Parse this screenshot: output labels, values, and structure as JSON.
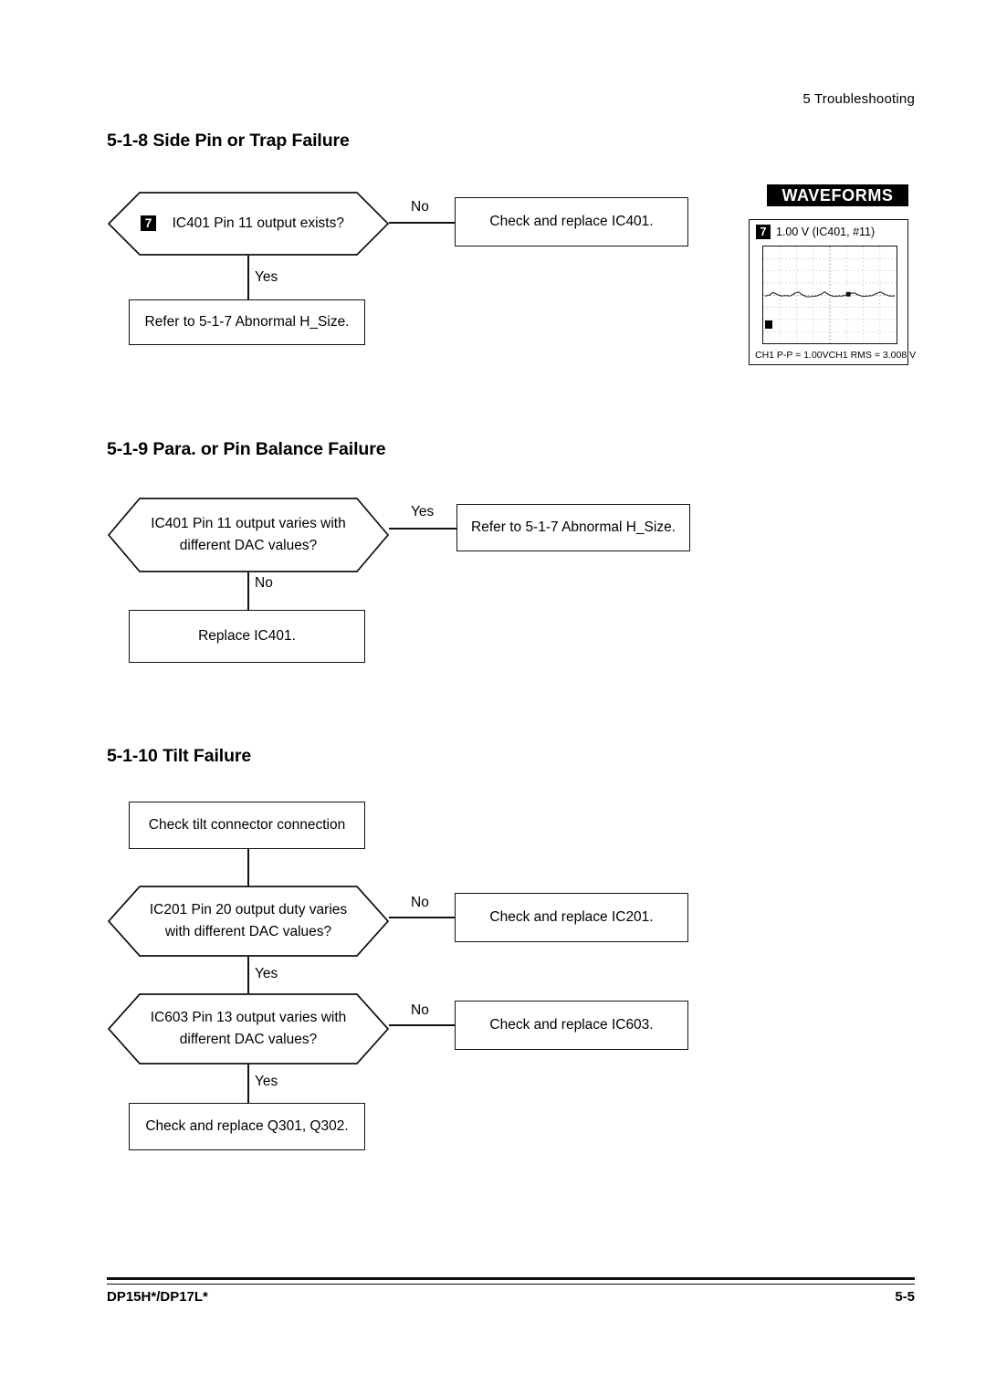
{
  "header": {
    "running_head": "5 Troubleshooting"
  },
  "sections": [
    {
      "title": "5-1-8 Side Pin or Trap Failure",
      "nodes": {
        "decision": {
          "badge": "7",
          "text": "IC401 Pin 11 output exists?"
        },
        "no_branch_label": "No",
        "no_box": "Check and replace IC401.",
        "yes_branch_label": "Yes",
        "yes_box": "Refer to 5-1-7 Abnormal H_Size."
      }
    },
    {
      "title": "5-1-9 Para. or Pin Balance Failure",
      "nodes": {
        "decision": {
          "line1": "IC401 Pin 11 output varies with",
          "line2": "different DAC values?"
        },
        "yes_branch_label": "Yes",
        "yes_box": "Refer to 5-1-7 Abnormal H_Size.",
        "no_branch_label": "No",
        "no_box": "Replace IC401."
      }
    },
    {
      "title": "5-1-10 Tilt Failure",
      "nodes": {
        "start_box": "Check tilt connector connection",
        "decision1": {
          "line1": "IC201 Pin 20 output duty varies",
          "line2": "with different DAC values?"
        },
        "decision1_no_label": "No",
        "decision1_no_box": "Check and replace IC201.",
        "decision1_yes_label": "Yes",
        "decision2": {
          "line1": "IC603 Pin 13 output varies with",
          "line2": "different DAC values?"
        },
        "decision2_no_label": "No",
        "decision2_no_box": "Check and replace IC603.",
        "decision2_yes_label": "Yes",
        "end_box": "Check and replace Q301, Q302."
      }
    }
  ],
  "waveforms": {
    "header_label": "WAVEFORMS",
    "entry": {
      "badge": "7",
      "caption": "1.00 V (IC401, #11)",
      "meas_left": "CH1 P-P = 1.00V",
      "meas_right": "CH1 RMS = 3.008 V"
    }
  },
  "footer": {
    "model": "DP15H*/DP17L*",
    "page": "5-5"
  }
}
